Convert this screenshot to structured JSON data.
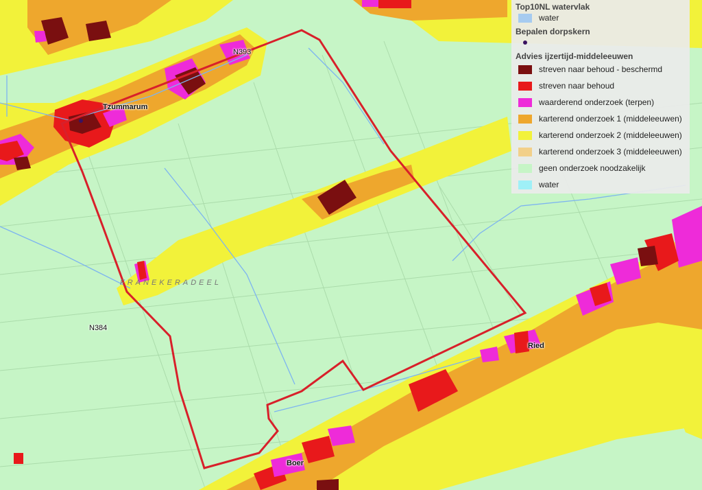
{
  "legend": {
    "groups": [
      {
        "title": "Top10NL watervlak",
        "items": [
          {
            "label": "water",
            "color": "#a6cbf0"
          }
        ]
      },
      {
        "title": "Bepalen dorpskern",
        "items": [
          {
            "label": "",
            "color": "#3a1260",
            "symbol": "dot"
          }
        ]
      },
      {
        "title": "Advies ijzertijd-middeleeuwen",
        "items": [
          {
            "label": "streven naar behoud - beschermd",
            "color": "#7a0f10"
          },
          {
            "label": "streven naar behoud",
            "color": "#e8191b"
          },
          {
            "label": "waarderend onderzoek (terpen)",
            "color": "#ee2bd9"
          },
          {
            "label": "karterend onderzoek 1 (middeleeuwen)",
            "color": "#eea72d"
          },
          {
            "label": "karterend onderzoek 2 (middeleeuwen)",
            "color": "#f2f23a"
          },
          {
            "label": "karterend onderzoek 3 (middeleeuwen)",
            "color": "#f2d08a"
          },
          {
            "label": "geen onderzoek noodzakelijk",
            "color": "#c6f5c6"
          },
          {
            "label": "water",
            "color": "#9ff0f7"
          }
        ]
      }
    ]
  },
  "map": {
    "place_labels": {
      "tzummarum": "Tzummarum",
      "ried": "Ried",
      "boer": "Boer",
      "road_n384": "N384",
      "road_n393": "N393",
      "region": "FRANEKERADEEL"
    },
    "colors": {
      "background": "#c6f5c6",
      "orange_zone": "#eea72d",
      "yellow_zone": "#f2f23a",
      "red_zone": "#e8191b",
      "dark_red_zone": "#7a0f10",
      "magenta_zone": "#ee2bd9",
      "water_line": "#7db4f0",
      "boundary": "#d8202a"
    }
  }
}
